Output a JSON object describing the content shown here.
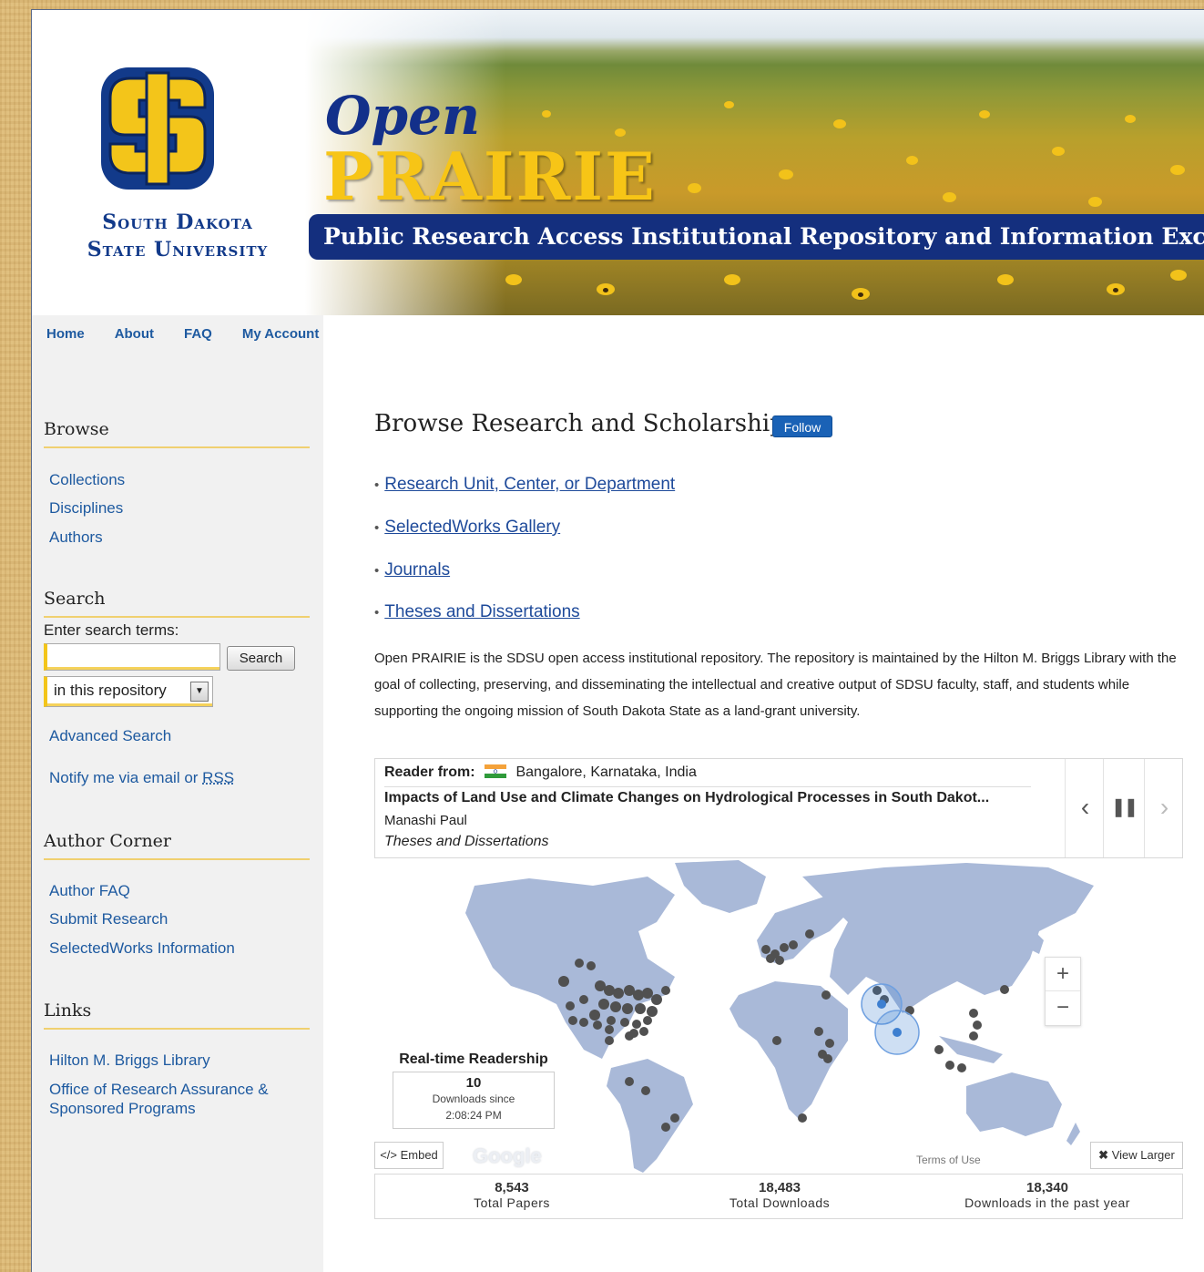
{
  "header": {
    "university_name_line1": "South Dakota",
    "university_name_line2": "State University",
    "brand_open": "Open",
    "brand_prairie": "PRAIRIE",
    "tagline": "Public Research Access Institutional Repository and Information Exchange",
    "logo_icon": "sdsu-logo-icon"
  },
  "nav": {
    "items": [
      "Home",
      "About",
      "FAQ",
      "My Account"
    ]
  },
  "sidebar": {
    "browse": {
      "heading": "Browse",
      "links": [
        "Collections",
        "Disciplines",
        "Authors"
      ]
    },
    "search": {
      "heading": "Search",
      "label": "Enter search terms:",
      "input_value": "",
      "button_label": "Search",
      "scope_selected": "in this repository",
      "advanced_link": "Advanced Search",
      "notify_text": "Notify me via email or",
      "notify_rss": "RSS"
    },
    "author_corner": {
      "heading": "Author Corner",
      "links": [
        "Author FAQ",
        "Submit Research",
        "SelectedWorks Information"
      ]
    },
    "links": {
      "heading": "Links",
      "items": [
        "Hilton M. Briggs Library",
        "Office of Research Assurance &",
        "Sponsored Programs"
      ]
    }
  },
  "main": {
    "title": "Browse Research and Scholarship",
    "follow_label": "Follow",
    "bullets": [
      "Research Unit, Center, or Department",
      "SelectedWorks Gallery",
      "Journals",
      "Theses and Dissertations"
    ],
    "description": "Open PRAIRIE is the SDSU open access institutional repository. The repository is maintained by the Hilton M. Briggs Library with the goal of collecting, preserving, and disseminating the intellectual and creative output of SDSU faculty, staff, and students while supporting the ongoing mission of South Dakota State as a land-grant university."
  },
  "readership": {
    "reader_from_label": "Reader from:",
    "location": "Bangalore, Karnataka, India",
    "flag_icon": "india-flag-icon",
    "paper_title": "Impacts of Land Use and Climate Changes on Hydrological Processes in South Dakot...",
    "author": "Manashi Paul",
    "collection": "Theses and Dissertations",
    "controls": {
      "prev": "‹",
      "pause": "❚❚",
      "next": "›"
    },
    "realtime_title": "Real-time Readership",
    "realtime_count": "10",
    "realtime_since": "Downloads since",
    "realtime_time": "2:08:24 PM",
    "zoom_in": "+",
    "zoom_out": "−",
    "embed_label": "</> Embed",
    "google_label": "Google",
    "terms_label": "Terms of Use",
    "view_larger_label": "View Larger",
    "map_land_color": "#a9b9d8",
    "map_point_color": "#505050",
    "map_highlight_color": "#3d7fd0"
  },
  "stats": [
    {
      "value": "8,543",
      "label": "Total Papers"
    },
    {
      "value": "18,483",
      "label": "Total Downloads"
    },
    {
      "value": "18,340",
      "label": "Downloads in the past year"
    }
  ],
  "colors": {
    "link_blue": "#1e5aa0",
    "brand_navy": "#142f7e",
    "brand_gold": "#f7c516",
    "follow_blue": "#1a62b6",
    "divider_gold": "#f0d070"
  }
}
